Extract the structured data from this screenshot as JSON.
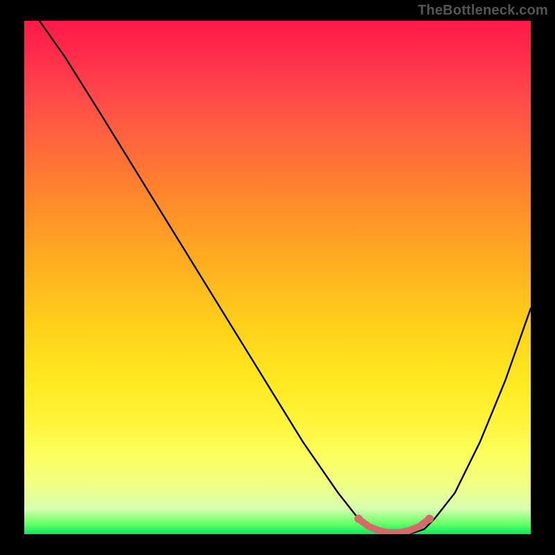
{
  "watermark": {
    "text": "TheBottleneck.com"
  },
  "chart_data": {
    "type": "line",
    "title": "",
    "xlabel": "",
    "ylabel": "",
    "xlim": [
      0,
      100
    ],
    "ylim": [
      0,
      100
    ],
    "series": [
      {
        "name": "bottleneck-curve",
        "color": "#000000",
        "x": [
          0,
          3,
          8,
          15,
          25,
          35,
          45,
          55,
          62,
          66,
          69,
          72,
          76,
          79,
          81,
          85,
          90,
          95,
          100
        ],
        "values": [
          107,
          100,
          93,
          82,
          66,
          50,
          34,
          18,
          8,
          3,
          1,
          0,
          0,
          1,
          3,
          8,
          18,
          30,
          44
        ]
      },
      {
        "name": "sweet-spot-band",
        "color": "#d46a6a",
        "x": [
          66,
          68,
          70,
          72,
          74,
          76,
          78,
          80
        ],
        "values": [
          3,
          1.5,
          0.7,
          0.3,
          0.3,
          0.7,
          1.5,
          3
        ]
      }
    ],
    "gradient": {
      "top": "#ff1a4a",
      "mid": "#ffd21a",
      "bottom": "#08e85e"
    }
  }
}
